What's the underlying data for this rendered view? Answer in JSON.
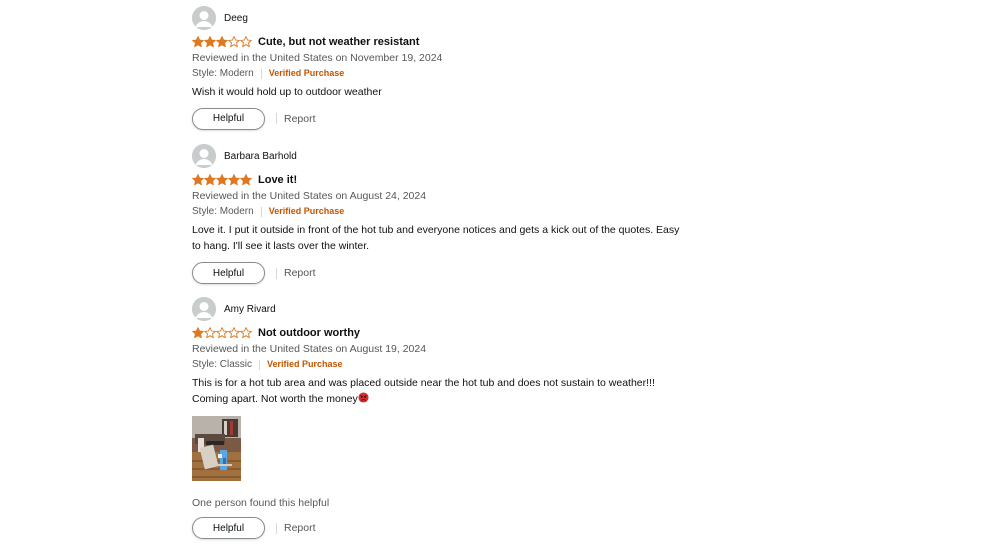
{
  "reviews": [
    {
      "profile_name": "Deeg",
      "rating": 3,
      "title": "Cute, but not weather resistant",
      "date": "Reviewed in the United States on November 19, 2024",
      "style": "Style: Modern",
      "verified": "Verified Purchase",
      "body": "Wish it would hold up to outdoor weather",
      "helpful_label": "Helpful",
      "report_label": "Report"
    },
    {
      "profile_name": "Barbara Barhold",
      "rating": 5,
      "title": "Love it!",
      "date": "Reviewed in the United States on August 24, 2024",
      "style": "Style: Modern",
      "verified": "Verified Purchase",
      "body_line1": "Love it. I put it outside in front of the hot tub and everyone notices and gets a kick out of the quotes. Easy",
      "body_line2": "to hang. I'll see it lasts over the winter.",
      "helpful_label": "Helpful",
      "report_label": "Report"
    },
    {
      "profile_name": "Amy Rivard",
      "rating": 1,
      "title": "Not outdoor worthy",
      "date": "Reviewed in the United States on August 19, 2024",
      "style": "Style: Classic",
      "verified": "Verified Purchase",
      "body_line1": "This is for a hot tub area and was placed outside near the hot tub and does not sustain to weather!!!",
      "body_line2": "Coming apart. Not worth the money",
      "emoji": "angry-face-icon",
      "helpful_count": "One person found this helpful",
      "helpful_label": "Helpful",
      "report_label": "Report"
    }
  ],
  "colors": {
    "star_fill": "#de7921",
    "verified": "#c45500",
    "muted_text": "#565959"
  }
}
